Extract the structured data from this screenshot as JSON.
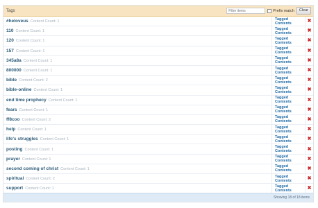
{
  "header": {
    "title": "Tags",
    "filter_placeholder": "Filter items",
    "prefix_label": "Prefix match",
    "clear_label": "Clear"
  },
  "rows": [
    {
      "name": "#heloveus",
      "count": "Content Count: 1",
      "action": "Tagged Contents"
    },
    {
      "name": "110",
      "count": "Content Count: 1",
      "action": "Tagged Contents"
    },
    {
      "name": "120",
      "count": "Content Count: 1",
      "action": "Tagged Contents"
    },
    {
      "name": "157",
      "count": "Content Count: 1",
      "action": "Tagged Contents"
    },
    {
      "name": "345a8a",
      "count": "Content Count: 1",
      "action": "Tagged Contents"
    },
    {
      "name": "800000",
      "count": "Content Count: 1",
      "action": "Tagged Contents"
    },
    {
      "name": "bible",
      "count": "Content Count: 2",
      "action": "Tagged Contents"
    },
    {
      "name": "bible-online",
      "count": "Content Count: 1",
      "action": "Tagged Contents"
    },
    {
      "name": "end time prophecy",
      "count": "Content Count: 1",
      "action": "Tagged Contents"
    },
    {
      "name": "fears",
      "count": "Content Count: 1",
      "action": "Tagged Contents"
    },
    {
      "name": "ff8coo",
      "count": "Content Count: 2",
      "action": "Tagged Contents"
    },
    {
      "name": "help",
      "count": "Content Count: 1",
      "action": "Tagged Contents"
    },
    {
      "name": "life's struggles",
      "count": "Content Count: 1",
      "action": "Tagged Contents"
    },
    {
      "name": "posting",
      "count": "Content Count: 1",
      "action": "Tagged Contents"
    },
    {
      "name": "prayer",
      "count": "Content Count: 1",
      "action": "Tagged Contents"
    },
    {
      "name": "second coming of christ",
      "count": "Content Count: 1",
      "action": "Tagged Contents"
    },
    {
      "name": "spiritual",
      "count": "Content Count: 2",
      "action": "Tagged Contents"
    },
    {
      "name": "support",
      "count": "Content Count: 1",
      "action": "Tagged Contents"
    }
  ],
  "footer": {
    "status": "Showing 18 of 18 items"
  },
  "icons": {
    "delete": "delete-x-icon"
  },
  "colors": {
    "header_bg": "#f9e4c1",
    "link": "#1f6aa5",
    "delete": "#cc2a2a",
    "footer_bg": "#deeaf6"
  }
}
